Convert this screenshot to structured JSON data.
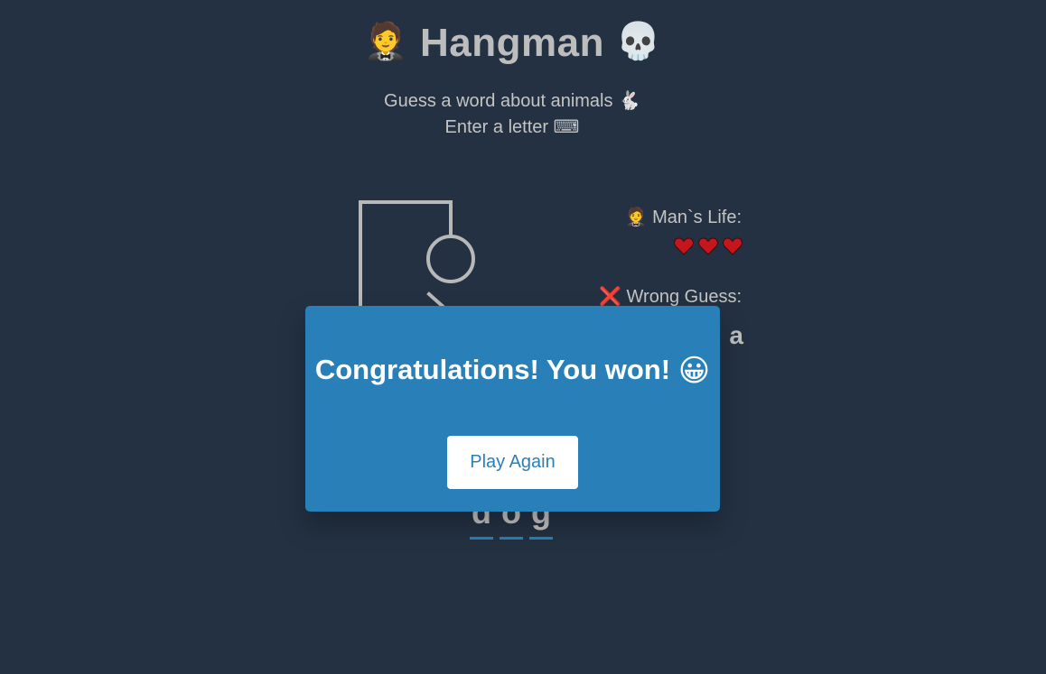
{
  "header": {
    "title_prefix_icon": "man-in-tuxedo-icon",
    "title_prefix_emoji": "🤵",
    "title": "Hangman",
    "title_suffix_icon": "skull-icon",
    "title_suffix_emoji": "💀",
    "subtitle": "Guess a word about animals 🐇",
    "instruction": "Enter a letter ⌨"
  },
  "info": {
    "lives_label": "🤵 Man`s Life:",
    "lives_remaining": 3,
    "heart_color": "#c4161c",
    "wrong_label": "❌ Wrong Guess:",
    "wrong_letters": "a"
  },
  "word": {
    "letters": [
      "d",
      "o",
      "g"
    ],
    "underline_color": "#2980b9"
  },
  "popup": {
    "message": "Congratulations! You won!",
    "emoji": "😀",
    "emoji_icon": "grinning-face-icon",
    "button_label": "Play Again",
    "background": "#2980b9"
  },
  "colors": {
    "background": "#233142",
    "text": "#c4c4c4",
    "accent": "#2980b9"
  }
}
